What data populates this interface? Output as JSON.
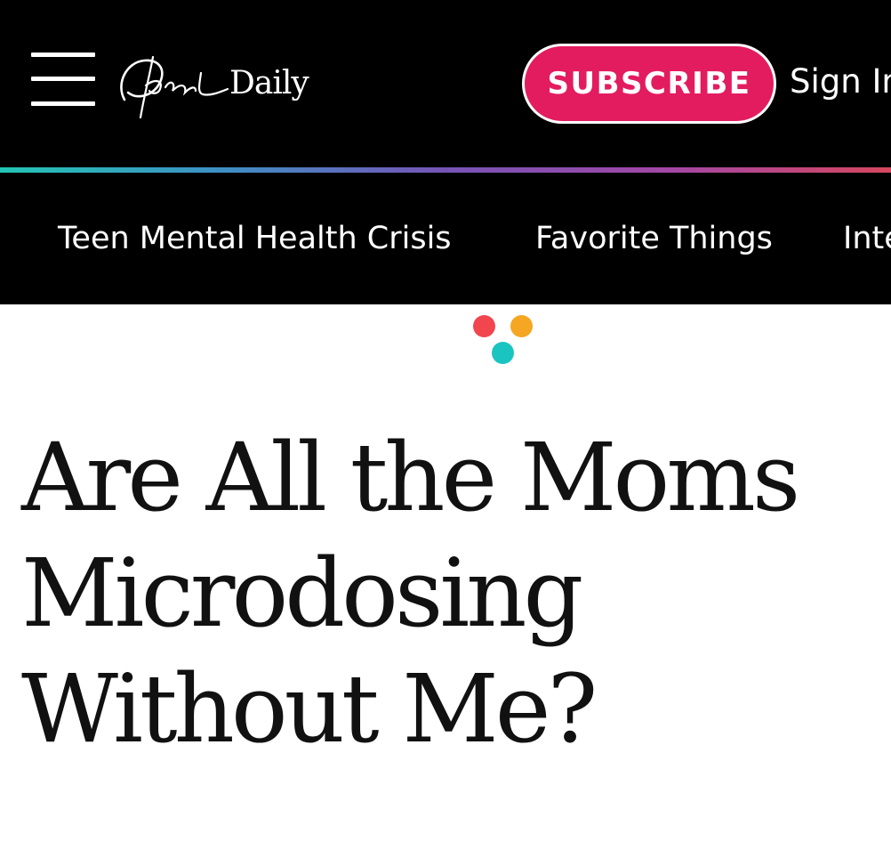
{
  "header": {
    "logo_script": "Oprah",
    "logo_word": "Daily",
    "subscribe_label": "SUBSCRIBE",
    "sign_in_label": "Sign In"
  },
  "nav": {
    "items": [
      {
        "label": "Teen Mental Health Crisis"
      },
      {
        "label": "Favorite Things"
      },
      {
        "label": "Interviews"
      }
    ]
  },
  "article": {
    "title": "Are All the Moms Microdosing Without Me?"
  },
  "colors": {
    "header_bg": "#000000",
    "accent": "#e31c5f",
    "dot_red": "#f2464f",
    "dot_orange": "#f5a623",
    "dot_teal": "#1ac5c1",
    "divider_gradient": [
      "#23c4b5",
      "#3f8fc4",
      "#7654b6",
      "#a347a6",
      "#d5475e"
    ]
  },
  "icons": {
    "menu": "hamburger-menu-icon",
    "brand_mark": "three-dots-logo-icon"
  }
}
